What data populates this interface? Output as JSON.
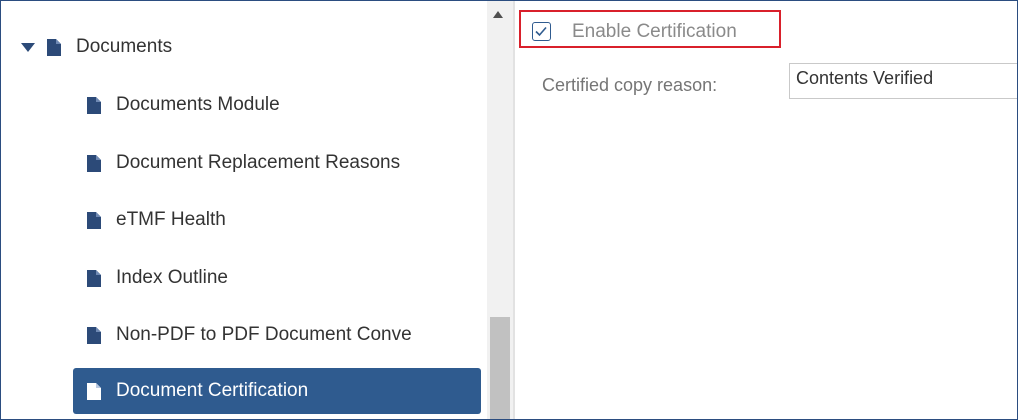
{
  "tree": {
    "parent": {
      "label": "Documents",
      "expanded": true
    },
    "children": [
      {
        "label": "Documents Module",
        "selected": false
      },
      {
        "label": "Document Replacement Reasons",
        "selected": false
      },
      {
        "label": "eTMF Health",
        "selected": false
      },
      {
        "label": "Index Outline",
        "selected": false
      },
      {
        "label": "Non-PDF to PDF Document Conve",
        "selected": false
      },
      {
        "label": "Document Certification",
        "selected": true
      }
    ]
  },
  "settings": {
    "enable_certification": {
      "label": "Enable Certification",
      "checked": true
    },
    "certified_copy_reason": {
      "label": "Certified copy reason:",
      "value": "Contents Verified"
    }
  },
  "colors": {
    "selected_bg": "#2f5b8f",
    "icon": "#2c4a78",
    "highlight": "#d9202b",
    "frame_border": "#2b4d80"
  },
  "icons": {
    "expand": "caret-down-icon",
    "node": "document-icon",
    "checkbox": "checkmark-icon",
    "scroll": "scroll-up-icon"
  }
}
